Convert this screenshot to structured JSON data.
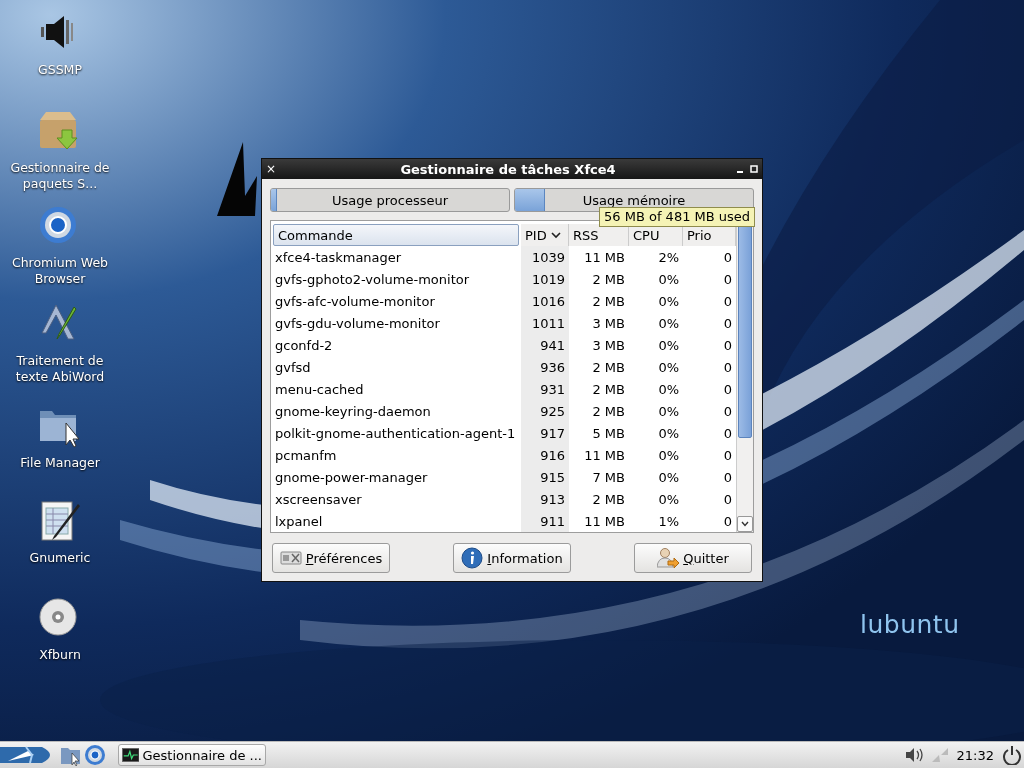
{
  "desktop_icons": [
    {
      "kind": "speaker",
      "label": "GSSMP"
    },
    {
      "kind": "package",
      "label": "Gestionnaire de paquets S..."
    },
    {
      "kind": "browser",
      "label": "Chromium Web Browser"
    },
    {
      "kind": "writer",
      "label": "Traitement de texte AbiWord"
    },
    {
      "kind": "folder",
      "label": "File Manager"
    },
    {
      "kind": "sheet",
      "label": "Gnumeric"
    },
    {
      "kind": "disc",
      "label": "Xfburn"
    }
  ],
  "wallpaper_logo": "lubuntu",
  "window": {
    "title": "Gestionnaire de tâches Xfce4",
    "close": "×",
    "meters": [
      {
        "label": "Usage processeur",
        "level": 0.02
      },
      {
        "label": "Usage mémoire",
        "level": 0.12
      }
    ],
    "tooltip": "56 MB of 481 MB used",
    "table": {
      "columns": [
        {
          "label": "Commande",
          "sorted": false
        },
        {
          "label": "PID",
          "sorted": true
        },
        {
          "label": "RSS",
          "sorted": false
        },
        {
          "label": "CPU",
          "sorted": false
        },
        {
          "label": "Prio",
          "sorted": false
        }
      ],
      "rows": [
        [
          "xfce4-taskmanager",
          "1039",
          "11 MB",
          "2%",
          "0"
        ],
        [
          "gvfs-gphoto2-volume-monitor",
          "1019",
          "2 MB",
          "0%",
          "0"
        ],
        [
          "gvfs-afc-volume-monitor",
          "1016",
          "2 MB",
          "0%",
          "0"
        ],
        [
          "gvfs-gdu-volume-monitor",
          "1011",
          "3 MB",
          "0%",
          "0"
        ],
        [
          "gconfd-2",
          "941",
          "3 MB",
          "0%",
          "0"
        ],
        [
          "gvfsd",
          "936",
          "2 MB",
          "0%",
          "0"
        ],
        [
          "menu-cached",
          "931",
          "2 MB",
          "0%",
          "0"
        ],
        [
          "gnome-keyring-daemon",
          "925",
          "2 MB",
          "0%",
          "0"
        ],
        [
          "polkit-gnome-authentication-agent-1",
          "917",
          "5 MB",
          "0%",
          "0"
        ],
        [
          "pcmanfm",
          "916",
          "11 MB",
          "0%",
          "0"
        ],
        [
          "gnome-power-manager",
          "915",
          "7 MB",
          "0%",
          "0"
        ],
        [
          "xscreensaver",
          "913",
          "2 MB",
          "0%",
          "0"
        ],
        [
          "lxpanel",
          "911",
          "11 MB",
          "1%",
          "0"
        ]
      ]
    },
    "buttons": [
      {
        "kind": "prefs",
        "mnemonic": "P",
        "rest": "références"
      },
      {
        "kind": "info",
        "mnemonic": "I",
        "rest": "nformation"
      },
      {
        "kind": "quit",
        "mnemonic": "Q",
        "rest": "uitter"
      }
    ]
  },
  "taskbar": {
    "task": "Gestionnaire de ...",
    "clock": "21:32"
  }
}
